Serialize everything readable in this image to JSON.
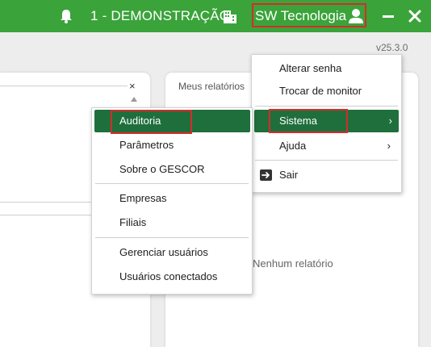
{
  "header": {
    "company": "1 - DEMONSTRAÇÃO",
    "user": "SW Tecnologia",
    "icons": [
      "bell-icon",
      "building-icon",
      "user-icon",
      "minimize-icon",
      "close-icon"
    ]
  },
  "version": "v25.3.0",
  "panels": {
    "left": {
      "close": "×"
    },
    "right": {
      "title": "Meus relatórios",
      "empty_text": "Nenhum relatório"
    }
  },
  "user_menu": {
    "items": [
      {
        "label": "Alterar senha"
      },
      {
        "label": "Trocar de monitor"
      },
      {
        "label": "Sistema",
        "submenu": true
      },
      {
        "label": "Ajuda",
        "submenu": true
      },
      {
        "label": "Sair",
        "icon": "exit-icon"
      }
    ]
  },
  "sistema_menu": {
    "items": [
      {
        "label": "Auditoria"
      },
      {
        "label": "Parâmetros"
      },
      {
        "label": "Sobre o GESCOR"
      },
      {
        "label": "Empresas"
      },
      {
        "label": "Filiais"
      },
      {
        "label": "Gerenciar usuários"
      },
      {
        "label": "Usuários conectados"
      }
    ]
  },
  "colors": {
    "header_bg": "#3aa33a",
    "menu_highlight": "#1f6f3c",
    "annotation": "#d62b2b"
  }
}
